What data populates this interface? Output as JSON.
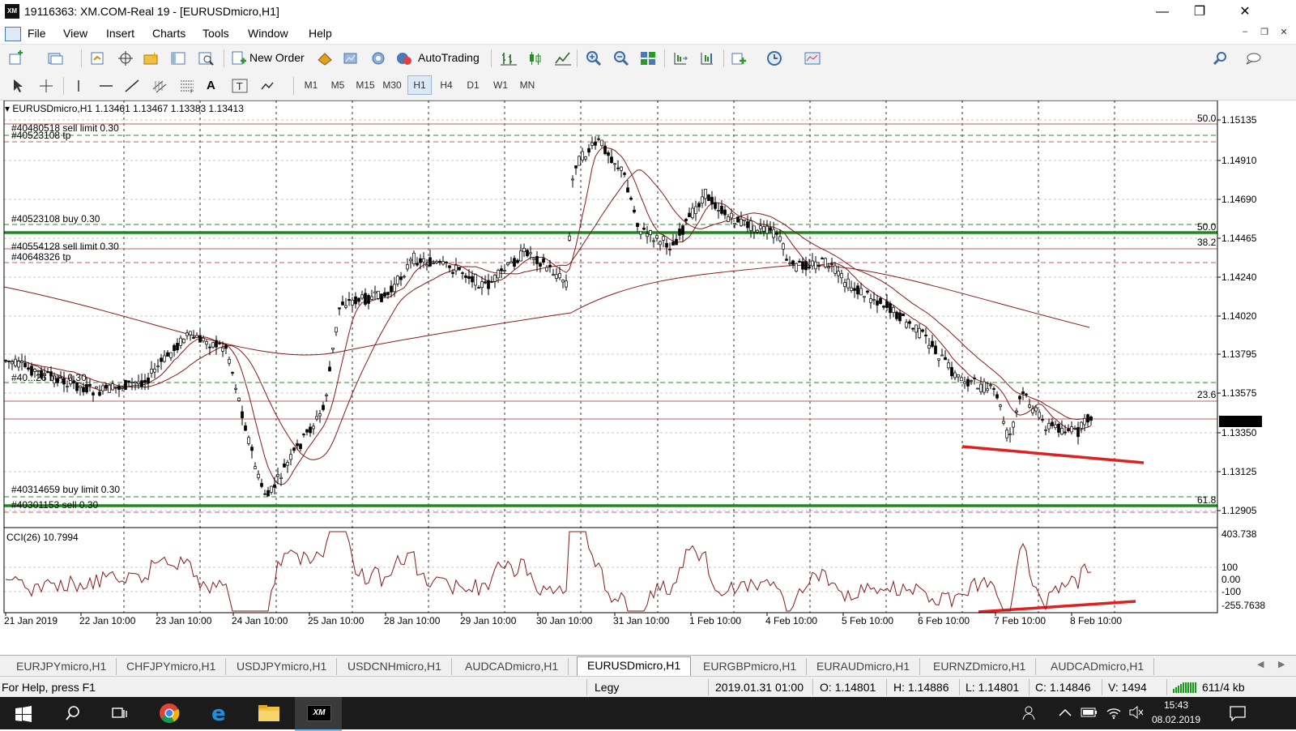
{
  "window": {
    "title": "19116363: XM.COM-Real 19 - [EURUSDmicro,H1]",
    "app_logo": "XM"
  },
  "menu": [
    "File",
    "View",
    "Insert",
    "Charts",
    "Tools",
    "Window",
    "Help"
  ],
  "toolbar": {
    "new_order_label": "New Order",
    "autotrading_label": "AutoTrading"
  },
  "timeframes": [
    "M1",
    "M5",
    "M15",
    "M30",
    "H1",
    "H4",
    "D1",
    "W1",
    "MN"
  ],
  "active_timeframe": "H1",
  "chart": {
    "header": "EURUSDmicro,H1  1.13461 1.13467 1.13383 1.13413",
    "price_ticks": [
      "1.15135",
      "1.14910",
      "1.14690",
      "1.14465",
      "1.14240",
      "1.14020",
      "1.13795",
      "1.13575",
      "1.13350",
      "1.13125",
      "1.12905"
    ],
    "current_price": "1.13413",
    "date_ticks": [
      "21 Jan 2019",
      "22 Jan 10:00",
      "23 Jan 10:00",
      "24 Jan 10:00",
      "25 Jan 10:00",
      "28 Jan 10:00",
      "29 Jan 10:00",
      "30 Jan 10:00",
      "31 Jan 10:00",
      "1 Feb 10:00",
      "4 Feb 10:00",
      "5 Feb 10:00",
      "6 Feb 10:00",
      "7 Feb 10:00",
      "8 Feb 10:00"
    ],
    "order_labels": [
      "#40480518 sell limit 0.30",
      "#40523108 tp",
      "#40523108 buy 0.30",
      "#40554128 sell limit 0.30",
      "#40648326 tp",
      "#40...26 buy 0.30",
      "#40314659 buy limit 0.30",
      "#40301153 sell 0.30"
    ],
    "fib_labels": [
      "50.0",
      "50.0",
      "38.2",
      "23.6",
      "61.8"
    ],
    "indicator": {
      "label": "CCI(26) 10.7994",
      "ticks": [
        "403.738",
        "100",
        "0.00",
        "-100",
        "-255.7638"
      ]
    },
    "colors": {
      "candles": "#000000",
      "ma": "#8b1a1a",
      "green_levels": "#1a8c1a",
      "red_levels": "#c0392b",
      "trendline": "#e02020",
      "fib": "#c0392b"
    }
  },
  "tabs": [
    "EURJPYmicro,H1",
    "CHFJPYmicro,H1",
    "USDJPYmicro,H1",
    "USDCNHmicro,H1",
    "AUDCADmicro,H1",
    "EURUSDmicro,H1",
    "EURGBPmicro,H1",
    "EURAUDmicro,H1",
    "EURNZDmicro,H1",
    "AUDCADmicro,H1"
  ],
  "active_tab": "EURUSDmicro,H1",
  "status": {
    "help": "For Help, press F1",
    "profile": "Legy",
    "datetime": "2019.01.31 01:00",
    "open": "O: 1.14801",
    "high": "H: 1.14886",
    "low": "L: 1.14801",
    "close": "C: 1.14846",
    "volume": "V: 1494",
    "traffic": "611/4 kb"
  },
  "taskbar": {
    "time": "15:43",
    "date": "08.02.2019",
    "xm_label": "XM"
  }
}
